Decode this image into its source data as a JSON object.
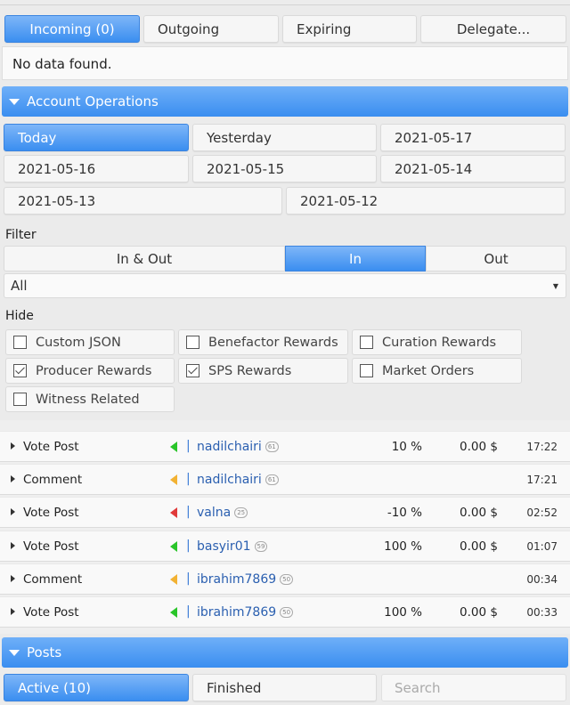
{
  "delegation_tabs": [
    {
      "label": "Incoming (0)",
      "active": true
    },
    {
      "label": "Outgoing",
      "active": false
    },
    {
      "label": "Expiring",
      "active": false
    },
    {
      "label": "Delegate...",
      "active": false
    }
  ],
  "no_data_text": "No data found.",
  "account_operations": {
    "title": "Account Operations",
    "date_buttons": [
      "Today",
      "Yesterday",
      "2021-05-17",
      "2021-05-16",
      "2021-05-15",
      "2021-05-14",
      "2021-05-13",
      "2021-05-12"
    ],
    "active_date": "Today",
    "filter_label": "Filter",
    "filter_segments": [
      "In & Out",
      "In",
      "Out"
    ],
    "active_filter": "In",
    "type_select_value": "All",
    "hide_label": "Hide",
    "hide_options": [
      {
        "label": "Custom JSON",
        "checked": false
      },
      {
        "label": "Benefactor Rewards",
        "checked": false
      },
      {
        "label": "Curation Rewards",
        "checked": false
      },
      {
        "label": "Producer Rewards",
        "checked": true
      },
      {
        "label": "SPS Rewards",
        "checked": true
      },
      {
        "label": "Market Orders",
        "checked": false
      },
      {
        "label": "Witness Related",
        "checked": false
      }
    ],
    "operations": [
      {
        "type": "Vote Post",
        "flag": "green",
        "user": "nadilchairi",
        "rep": "61",
        "percent": "10 %",
        "amount": "0.00 $",
        "time": "17:22"
      },
      {
        "type": "Comment",
        "flag": "orange",
        "user": "nadilchairi",
        "rep": "61",
        "percent": "",
        "amount": "",
        "time": "17:21"
      },
      {
        "type": "Vote Post",
        "flag": "red",
        "user": "valna",
        "rep": "25",
        "percent": "-10 %",
        "amount": "0.00 $",
        "time": "02:52"
      },
      {
        "type": "Vote Post",
        "flag": "green",
        "user": "basyir01",
        "rep": "59",
        "percent": "100 %",
        "amount": "0.00 $",
        "time": "01:07"
      },
      {
        "type": "Comment",
        "flag": "orange",
        "user": "ibrahim7869",
        "rep": "50",
        "percent": "",
        "amount": "",
        "time": "00:34"
      },
      {
        "type": "Vote Post",
        "flag": "green",
        "user": "ibrahim7869",
        "rep": "50",
        "percent": "100 %",
        "amount": "0.00 $",
        "time": "00:33"
      }
    ]
  },
  "posts": {
    "title": "Posts",
    "tabs": [
      {
        "label": "Active (10)",
        "active": true
      },
      {
        "label": "Finished",
        "active": false
      }
    ],
    "search_placeholder": "Search"
  },
  "colors": {
    "accent_blue": "#3a8ef0",
    "vote_green": "#2ac52a",
    "comment_orange": "#f2b233",
    "downvote_red": "#e03a3a",
    "link_blue": "#2a5fb0"
  }
}
